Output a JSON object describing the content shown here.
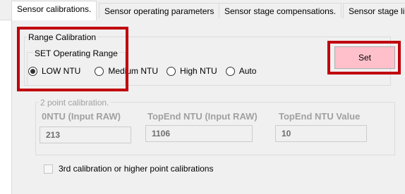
{
  "tabs": [
    {
      "label": "Sensor calibrations.",
      "active": true
    },
    {
      "label": "Sensor operating parameters",
      "active": false
    },
    {
      "label": "Sensor stage compensations.",
      "active": false
    },
    {
      "label": "Sensor stage li",
      "active": false
    }
  ],
  "range_calibration": {
    "title": "Range Calibration",
    "operating_range": {
      "title": "SET Operating Range",
      "options": [
        {
          "label": "LOW NTU",
          "selected": true
        },
        {
          "label": "Medium NTU",
          "selected": false
        },
        {
          "label": "High NTU",
          "selected": false
        },
        {
          "label": "Auto",
          "selected": false
        }
      ]
    },
    "set_button_label": "Set"
  },
  "two_point": {
    "title": "2 point calibration.",
    "columns": [
      "0NTU (Input RAW)",
      "TopEnd NTU (Input RAW)",
      "TopEnd NTU Value"
    ],
    "values": [
      "213",
      "1106",
      "10"
    ]
  },
  "third_calibration": {
    "label": "3rd calibration or higher point calibrations",
    "checked": false
  },
  "colors": {
    "highlight_outline": "#c0000d",
    "set_button_bg": "#ffc0cb"
  }
}
